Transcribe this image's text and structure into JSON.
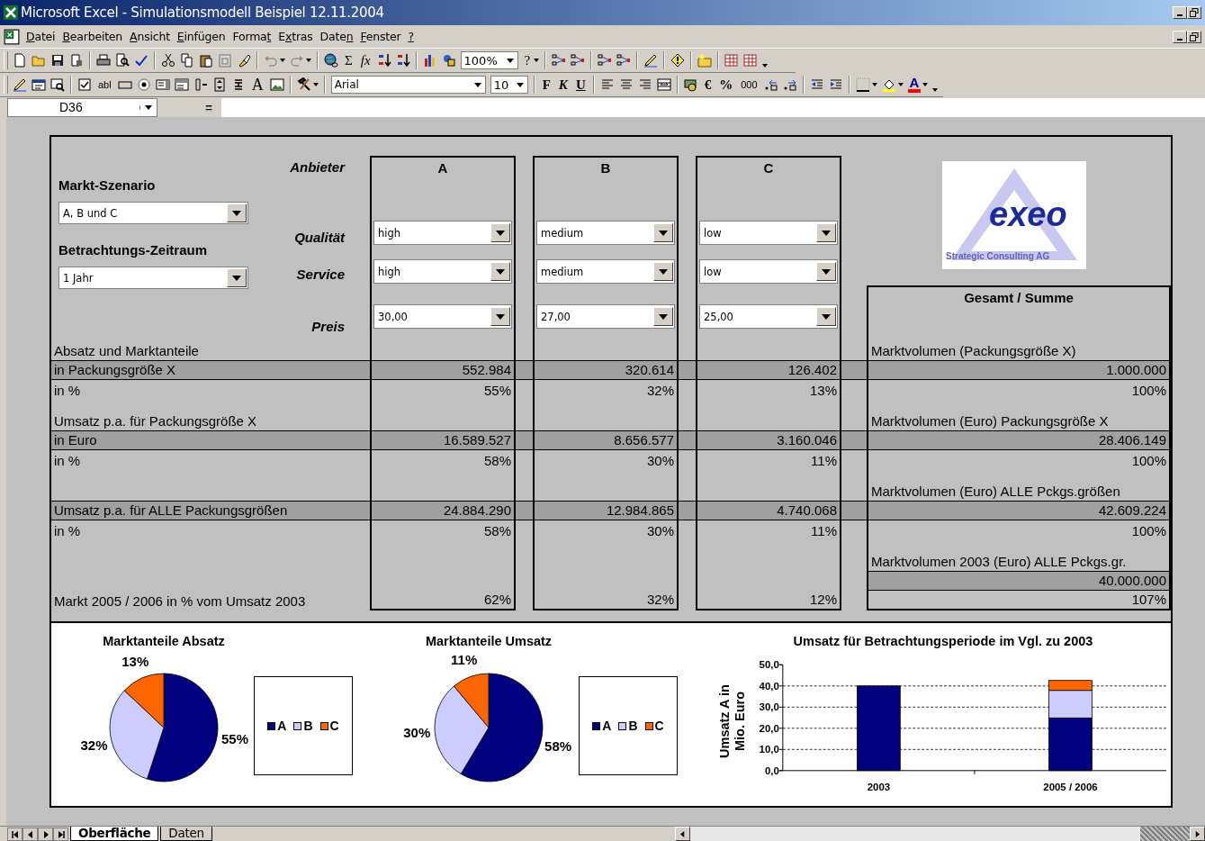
{
  "window": {
    "title": "Microsoft Excel - Simulationsmodell Beispiel 12.11.2004"
  },
  "menu": [
    {
      "key": "D",
      "after": "atei"
    },
    {
      "key": "B",
      "after": "earbeiten"
    },
    {
      "key": "A",
      "after": "nsicht"
    },
    {
      "key": "E",
      "after": "infügen"
    },
    {
      "before": "Forma",
      "key": "t"
    },
    {
      "before": "E",
      "key": "x",
      "after": "tras"
    },
    {
      "before": "Date",
      "key": "n"
    },
    {
      "key": "F",
      "after": "enster"
    },
    {
      "key": "?"
    }
  ],
  "toolbar": {
    "glyphs": [
      "Σ",
      "fx",
      "?",
      "abl",
      "A",
      "F",
      "K",
      "U",
      "€",
      "%",
      "000",
      "A"
    ],
    "zoom": "100%",
    "font": "Arial",
    "font_size": "10"
  },
  "formula_bar": {
    "cell": "D36",
    "equals": "="
  },
  "controls": {
    "scenario_label": "Markt-Szenario",
    "scenario": "A, B und C",
    "period_label": "Betrachtungs-Zeitraum",
    "period": "1 Jahr"
  },
  "supplier_label": "Anbieter",
  "attributes": [
    {
      "label": "Qualität"
    },
    {
      "label": "Service"
    },
    {
      "label": "Preis"
    }
  ],
  "suppliers": [
    {
      "name": "A",
      "choices": [
        "high",
        "high",
        "30,00"
      ]
    },
    {
      "name": "B",
      "choices": [
        "medium",
        "medium",
        "27,00"
      ]
    },
    {
      "name": "C",
      "choices": [
        "low",
        "low",
        "25,00"
      ]
    }
  ],
  "logo": {
    "word": "exeo",
    "tagline": "Strategic Consulting AG"
  },
  "total_header": "Gesamt / Summe",
  "rows": [
    {
      "kind": "heading",
      "label": "Absatz und Marktanteile",
      "total": "Marktvolumen (Packungsgröße X)"
    },
    {
      "kind": "shaded",
      "label": "in Packungsgröße X",
      "values": [
        "552.984",
        "320.614",
        "126.402"
      ],
      "total": "1.000.000"
    },
    {
      "kind": "plain",
      "label": "in %",
      "values": [
        "55%",
        "32%",
        "13%"
      ],
      "total": "100%"
    },
    {
      "kind": "spacer"
    },
    {
      "kind": "heading",
      "label": "Umsatz p.a. für Packungsgröße X",
      "total": "Marktvolumen (Euro) Packungsgröße X"
    },
    {
      "kind": "shaded",
      "label": "in Euro",
      "values": [
        "16.589.527",
        "8.656.577",
        "3.160.046"
      ],
      "total": "28.406.149"
    },
    {
      "kind": "plain",
      "label": "in %",
      "values": [
        "58%",
        "30%",
        "11%"
      ],
      "total": "100%"
    },
    {
      "kind": "spacer"
    },
    {
      "kind": "heading",
      "total": "Marktvolumen (Euro) ALLE Pckgs.größen"
    },
    {
      "kind": "shaded",
      "label": "Umsatz p.a. für ALLE Packungsgrößen",
      "values": [
        "24.884.290",
        "12.984.865",
        "4.740.068"
      ],
      "total": "42.609.224"
    },
    {
      "kind": "plain",
      "label": "in %",
      "values": [
        "58%",
        "30%",
        "11%"
      ],
      "total": "100%"
    },
    {
      "kind": "spacer"
    },
    {
      "kind": "heading",
      "total": "Marktvolumen 2003 (Euro) ALLE Pckgs.gr."
    },
    {
      "kind": "shaded_total",
      "total": "40.000.000"
    },
    {
      "kind": "plain",
      "label": "Markt 2005 / 2006 in % vom Umsatz 2003",
      "values": [
        "62%",
        "32%",
        "12%"
      ],
      "total": "107%"
    }
  ],
  "pies": [
    {
      "chart_data": {
        "type": "pie",
        "title": "Marktanteile Absatz",
        "categories": [
          "A",
          "B",
          "C"
        ],
        "values": [
          55,
          32,
          13
        ],
        "value_labels": [
          "55%",
          "32%",
          "13%"
        ],
        "colors": [
          "#000080",
          "#ccccff",
          "#ff6600"
        ],
        "legend": "right"
      }
    },
    {
      "chart_data": {
        "type": "pie",
        "title": "Marktanteile Umsatz",
        "categories": [
          "A",
          "B",
          "C"
        ],
        "values": [
          58,
          30,
          11
        ],
        "value_labels": [
          "58%",
          "30%",
          "11%"
        ],
        "colors": [
          "#000080",
          "#ccccff",
          "#ff6600"
        ],
        "legend": "right"
      }
    }
  ],
  "bar_chart": {
    "chart_data": {
      "type": "bar",
      "title": "Umsatz für Betrachtungsperiode im Vgl. zu 2003",
      "ylabel": "Umsatz A in Mio. Euro",
      "categories": [
        "2003",
        "2005 / 2006"
      ],
      "stacked": true,
      "grid": true,
      "ylim": [
        0,
        50
      ],
      "yticks": [
        {
          "value": 0,
          "label": "0,0"
        },
        {
          "value": 10,
          "label": "10,0"
        },
        {
          "value": 20,
          "label": "20,0"
        },
        {
          "value": 30,
          "label": "30,0"
        },
        {
          "value": 40,
          "label": "40,0"
        },
        {
          "value": 50,
          "label": "50,0"
        }
      ],
      "series": [
        {
          "color": "#000080",
          "values": [
            40.0,
            24.9
          ]
        },
        {
          "color": "#ccccff",
          "values": [
            null,
            13.0
          ]
        },
        {
          "color": "#ff6600",
          "values": [
            null,
            4.7
          ]
        }
      ]
    }
  },
  "sheet_tabs": [
    {
      "label": "Oberfläche",
      "selected": true
    },
    {
      "label": "Daten",
      "selected": false
    }
  ]
}
